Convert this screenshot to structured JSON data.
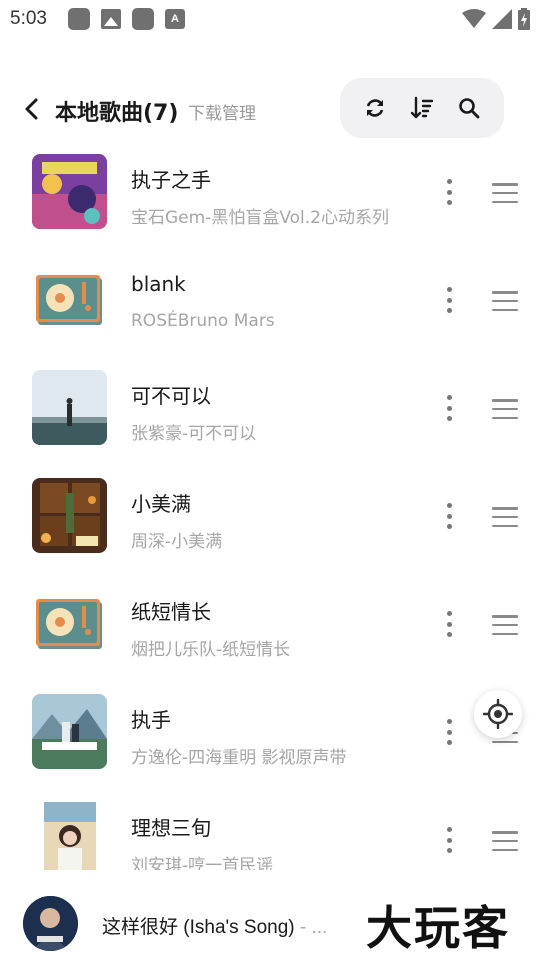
{
  "status_bar": {
    "time": "5:03",
    "notification_icons": [
      "app-icon",
      "image-icon",
      "app-icon",
      "a-icon"
    ],
    "a_glyph": "A",
    "right_icons": [
      "wifi-icon",
      "signal-icon",
      "battery-charging-icon"
    ]
  },
  "header": {
    "title": "本地歌曲(7)",
    "subtitle": "下载管理",
    "toolbar_icons": [
      "refresh-icon",
      "sort-icon",
      "search-icon"
    ]
  },
  "songs": [
    {
      "title": "执子之手",
      "artist": "宝石Gem-黑怕盲盒Vol.2心动系列",
      "cover": "album-art"
    },
    {
      "title": "blank",
      "artist": "ROSÉBruno Mars",
      "cover": "turntable-placeholder"
    },
    {
      "title": "可不可以",
      "artist": "张紫豪-可不可以",
      "cover": "album-art"
    },
    {
      "title": "小美满",
      "artist": "周深-小美满",
      "cover": "album-art"
    },
    {
      "title": "纸短情长",
      "artist": "烟把儿乐队-纸短情长",
      "cover": "turntable-placeholder"
    },
    {
      "title": "执手",
      "artist": "方逸伦-四海重明 影视原声带",
      "cover": "album-art"
    },
    {
      "title": "理想三旬",
      "artist": "刘安琪-哼一首民谣",
      "cover": "album-art"
    }
  ],
  "now_playing": {
    "title": "这样很好 (Isha's Song)",
    "separator": "- ...",
    "watermark": "大玩客"
  },
  "colors": {
    "toolbar_bg": "#f1f1f3",
    "secondary_text": "#a6a6a6",
    "icon_gray": "#777777"
  }
}
